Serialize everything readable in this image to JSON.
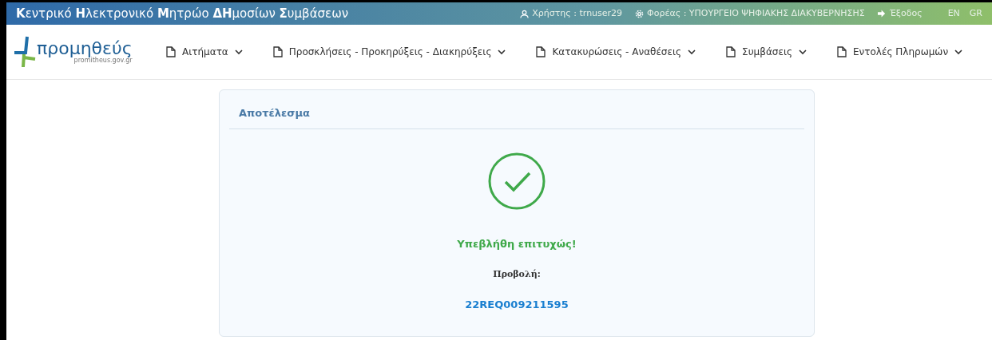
{
  "header": {
    "title": "**Κ**εντρικό **Η**λεκτρονικό **Μ**ητρώο **ΔΗ**μοσίων **Σ**υμβάσεων",
    "user": "Χρήστης : trnuser29",
    "organization": "Φορέας : ΥΠΟΥΡΓΕΙΟ ΨΗΦΙΑΚΗΣ ΔΙΑΚΥΒΕΡΝΗΣΗΣ",
    "logout": "Έξοδος",
    "languages": [
      "EN",
      "GR"
    ]
  },
  "logo": {
    "name": "προμηθεύς",
    "url": "promitheus.gov.gr"
  },
  "nav": [
    {
      "label": "Αιτήματα"
    },
    {
      "label": "Προσκλήσεις - Προκηρύξεις - Διακηρύξεις"
    },
    {
      "label": "Κατακυρώσεις - Αναθέσεις"
    },
    {
      "label": "Συμβάσεις"
    },
    {
      "label": "Εντολές Πληρωμών"
    }
  ],
  "result": {
    "title": "Αποτέλεσμα",
    "message": "Υπεβλήθη επιτυχώς!",
    "view_label": "Προβολή:",
    "reference": "22REQ009211595"
  }
}
